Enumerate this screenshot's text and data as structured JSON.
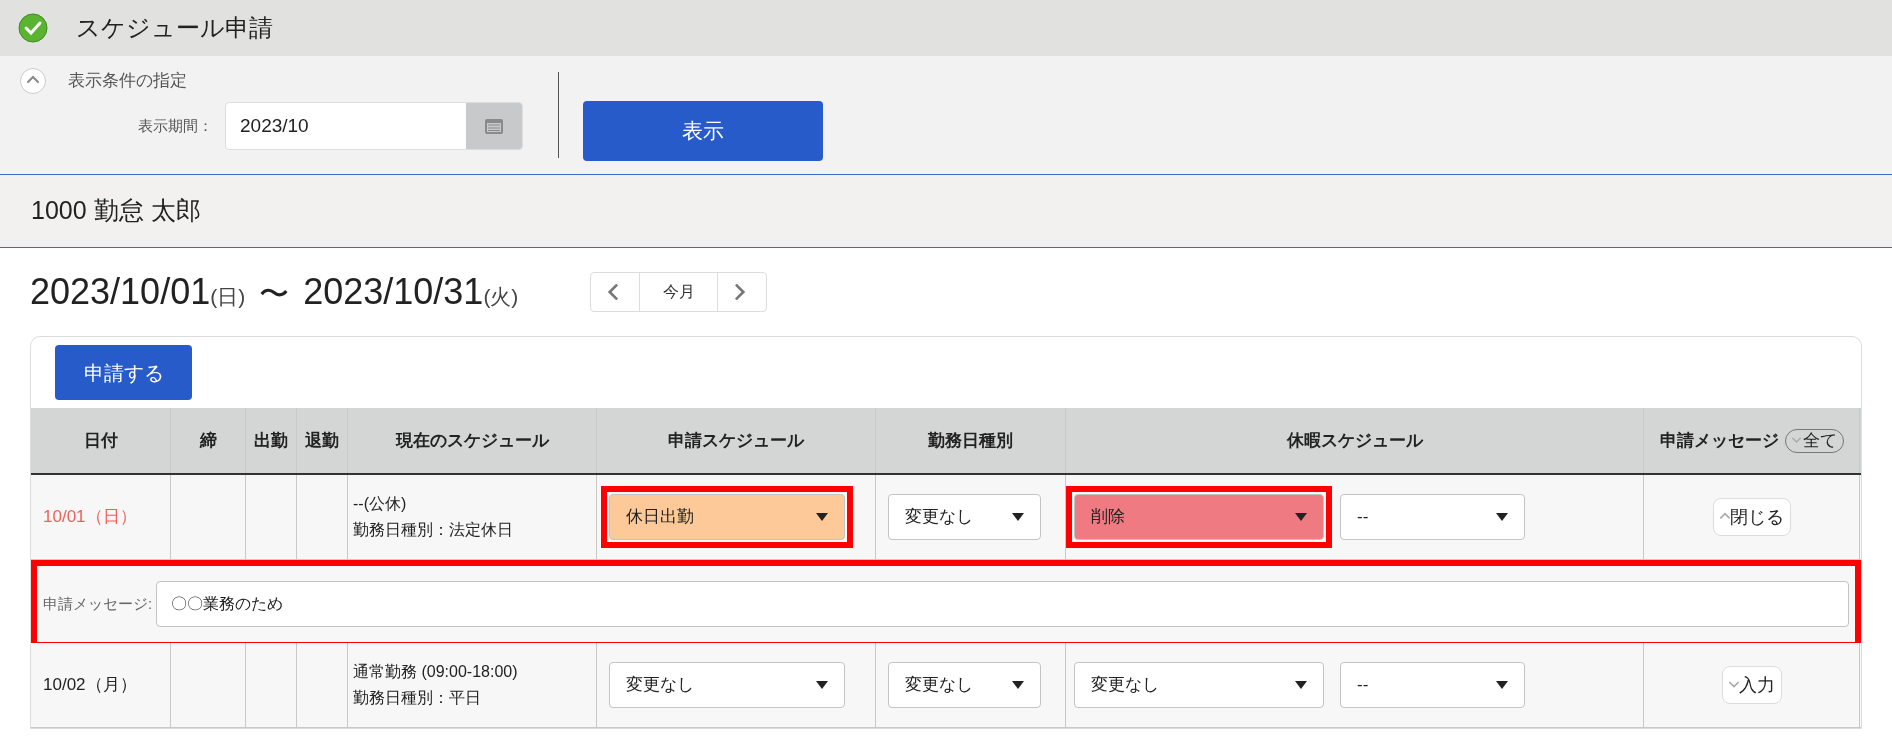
{
  "page_title": "スケジュール申請",
  "filter": {
    "heading": "表示条件の指定",
    "expanded": true,
    "period_label": "表示期間：",
    "period_value": "2023/10",
    "show_button": "表示"
  },
  "employee": "1000 勤怠 太郎",
  "period": {
    "start": "2023/10/01",
    "start_day": "(日)",
    "separator": "〜",
    "end": "2023/10/31",
    "end_day": "(火)",
    "current_button": "今月"
  },
  "apply_button": "申請する",
  "table": {
    "columns": [
      "日付",
      "締",
      "出勤",
      "退勤",
      "現在のスケジュール",
      "申請スケジュール",
      "勤務日種別",
      "休暇スケジュール",
      "申請メッセージ"
    ],
    "all_button": "全て",
    "rows": [
      {
        "date": "10/01（日）",
        "holiday": true,
        "current": [
          "--(公休)",
          "勤務日種別：法定休日"
        ],
        "schedule": {
          "value": "休日出勤",
          "color": "#fdc998",
          "highlighted": true
        },
        "day_type": {
          "value": "変更なし",
          "color": "#ffffff",
          "highlighted": false
        },
        "leave": {
          "value": "削除",
          "color": "#f07a82",
          "highlighted": true
        },
        "leave_sub": {
          "value": "--",
          "color": "#ffffff",
          "highlighted": false
        },
        "toggle": {
          "label": "閉じる",
          "expanded": true
        },
        "message": {
          "label": "申請メッセージ:",
          "value": "〇〇業務のため",
          "highlighted": true
        }
      },
      {
        "date": "10/02（月）",
        "holiday": false,
        "current": [
          "通常勤務 (09:00-18:00)",
          "勤務日種別：平日"
        ],
        "schedule": {
          "value": "変更なし",
          "color": "#ffffff",
          "highlighted": false
        },
        "day_type": {
          "value": "変更なし",
          "color": "#ffffff",
          "highlighted": false
        },
        "leave": {
          "value": "変更なし",
          "color": "#ffffff",
          "highlighted": false
        },
        "leave_sub": {
          "value": "--",
          "color": "#ffffff",
          "highlighted": false
        },
        "toggle": {
          "label": "入力",
          "expanded": false
        }
      }
    ]
  }
}
